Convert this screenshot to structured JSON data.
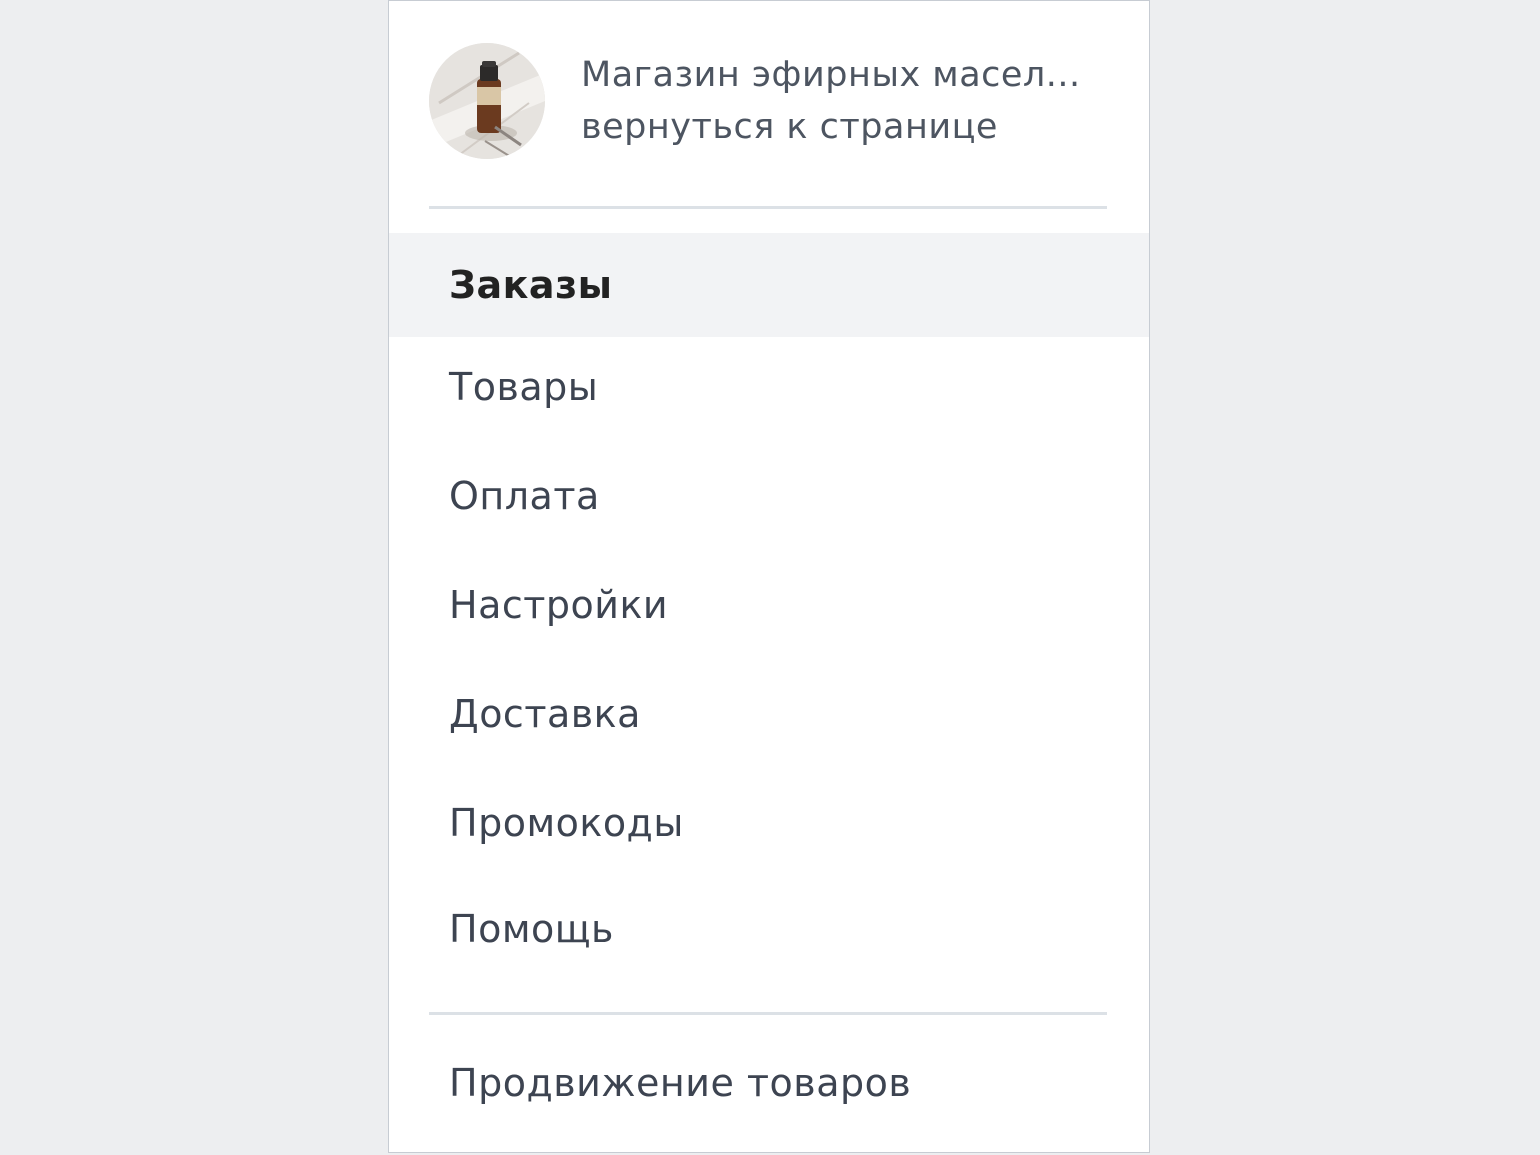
{
  "shop": {
    "name": "Магазин эфирных масел...",
    "back_label": "вернуться к странице",
    "avatar_icon": "essential-oil-bottle-photo"
  },
  "menu": {
    "items": [
      {
        "label": "Заказы",
        "active": true
      },
      {
        "label": "Товары",
        "active": false
      },
      {
        "label": "Оплата",
        "active": false
      },
      {
        "label": "Настройки",
        "active": false
      },
      {
        "label": "Доставка",
        "active": false
      },
      {
        "label": "Промокоды",
        "active": false
      },
      {
        "label": "Помощь",
        "active": false
      }
    ],
    "promo_label": "Продвижение товаров"
  },
  "colors": {
    "page_background": "#edeef0",
    "panel_background": "#ffffff",
    "active_item_background": "#f2f3f5",
    "text": "#3d4451",
    "divider": "#dce1e6"
  }
}
